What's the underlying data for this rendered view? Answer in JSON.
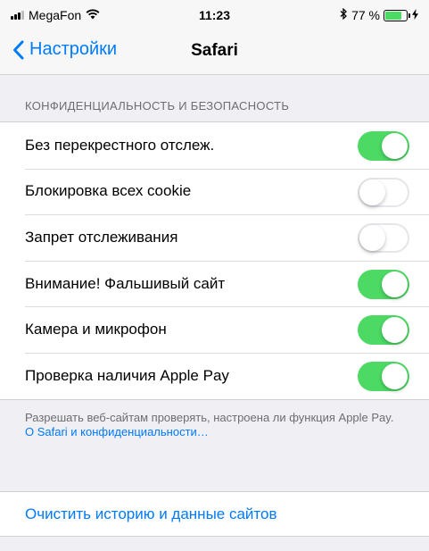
{
  "status_bar": {
    "carrier": "MegaFon",
    "time": "11:23",
    "battery_percent": "77 %",
    "battery_level": 0.77,
    "signal_bars": 3,
    "icons": [
      "signal-icon",
      "wifi-icon",
      "bluetooth-icon",
      "battery-icon",
      "charging-icon"
    ]
  },
  "navbar": {
    "back_label": "Настройки",
    "title": "Safari"
  },
  "privacy": {
    "header": "КОНФИДЕНЦИАЛЬНОСТЬ И БЕЗОПАСНОСТЬ",
    "items": [
      {
        "label": "Без перекрестного отслеж.",
        "enabled": true
      },
      {
        "label": "Блокировка всех cookie",
        "enabled": false
      },
      {
        "label": "Запрет отслеживания",
        "enabled": false
      },
      {
        "label": "Внимание! Фальшивый сайт",
        "enabled": true
      },
      {
        "label": "Камера и микрофон",
        "enabled": true
      },
      {
        "label": "Проверка наличия Apple Pay",
        "enabled": true
      }
    ],
    "footer_text": "Разрешать веб-сайтам проверять, настроена ли функция Apple Pay.",
    "footer_link": "О Safari и конфиденциальности…"
  },
  "clear_history": {
    "label": "Очистить историю и данные сайтов"
  },
  "colors": {
    "accent": "#007aff",
    "toggle_on": "#4cd964",
    "background": "#efeff4"
  }
}
